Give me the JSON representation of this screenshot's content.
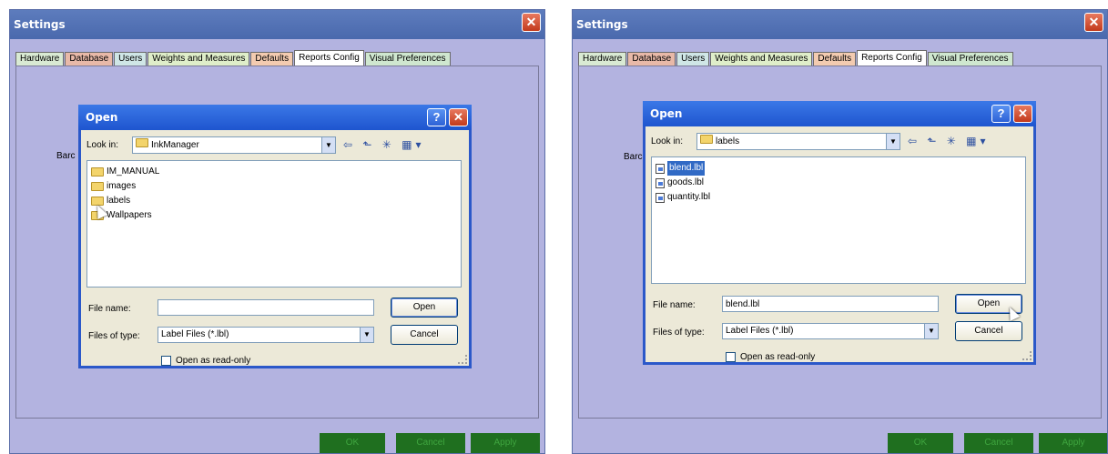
{
  "settings": {
    "title": "Settings",
    "close_glyph": "✕",
    "tabs": [
      "Hardware",
      "Database",
      "Users",
      "Weights and Measures",
      "Defaults",
      "Reports Config",
      "Visual Preferences"
    ],
    "tab_colors": [
      "#d9ead3",
      "#e8b9a8",
      "#cfe6e6",
      "#dfeec9",
      "#f3cbb0",
      "#ffffff",
      "#cfe7cf"
    ],
    "barc_label": "Barc",
    "ok_label": "OK",
    "cancel_label": "Cancel",
    "apply_label": "Apply"
  },
  "dialog": {
    "title": "Open",
    "help_glyph": "?",
    "close_glyph": "✕",
    "look_in_label": "Look in:",
    "file_name_label": "File name:",
    "files_of_type_label": "Files of type:",
    "files_of_type_value": "Label Files (*.lbl)",
    "open_button": "Open",
    "cancel_button": "Cancel",
    "read_only_label": "Open as read-only",
    "toolbar_icons": "⇦ ⬑ ✳ ▦▾",
    "dropdown_arrow": "▼"
  },
  "left_dialog": {
    "look_in_value": "InkManager",
    "items": [
      "IM_MANUAL",
      "images",
      "labels",
      "Wallpapers"
    ],
    "file_name_value": ""
  },
  "right_dialog": {
    "look_in_value": "labels",
    "items": [
      "blend.lbl",
      "goods.lbl",
      "quantity.lbl"
    ],
    "file_name_value": "blend.lbl"
  }
}
